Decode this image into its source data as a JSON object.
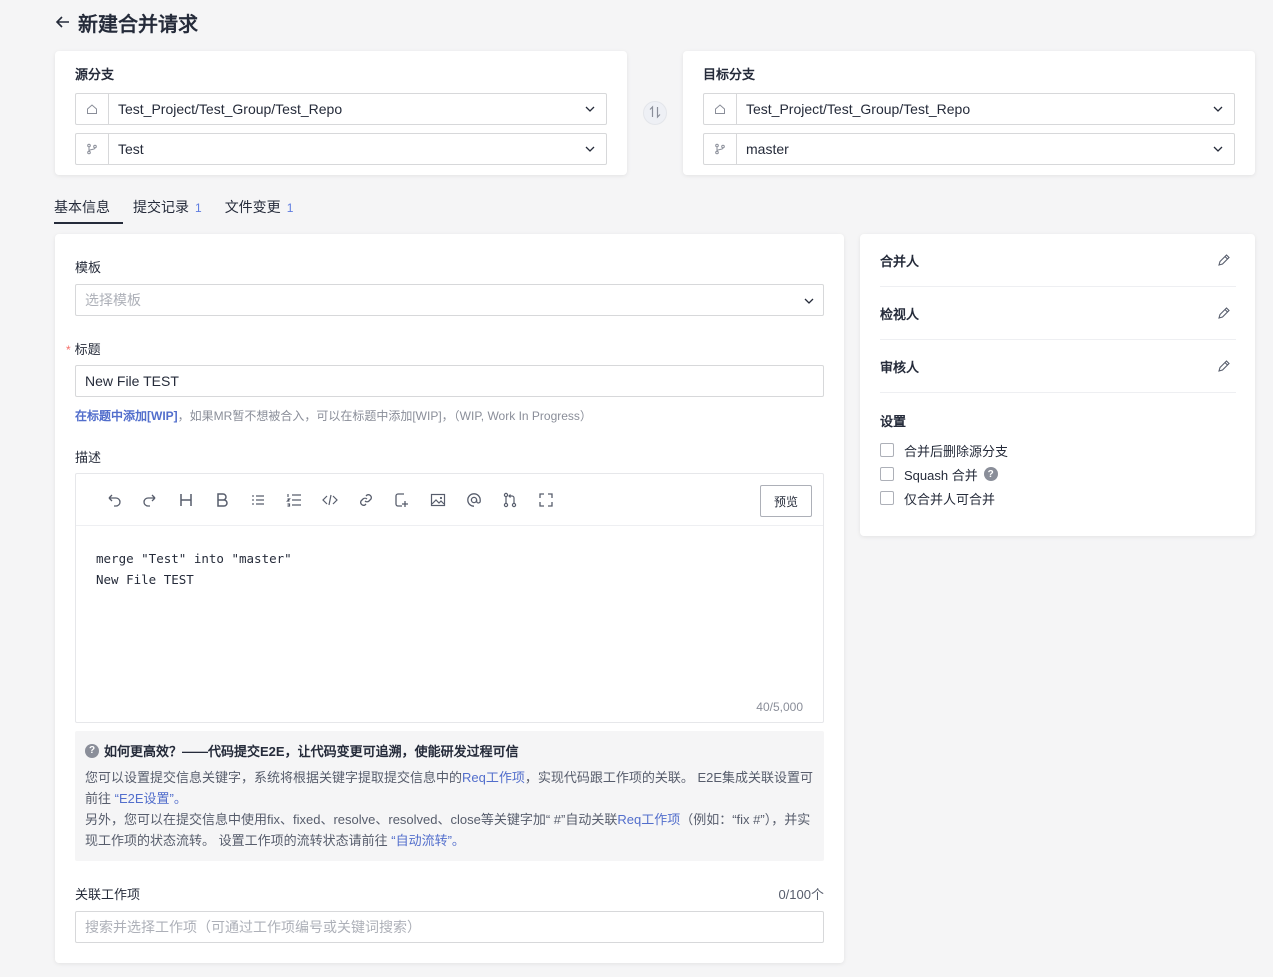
{
  "header": {
    "title": "新建合并请求"
  },
  "source": {
    "title": "源分支",
    "repo": "Test_Project/Test_Group/Test_Repo",
    "branch": "Test"
  },
  "target": {
    "title": "目标分支",
    "repo": "Test_Project/Test_Group/Test_Repo",
    "branch": "master"
  },
  "tabs": [
    {
      "label": "基本信息",
      "count": ""
    },
    {
      "label": "提交记录",
      "count": "1"
    },
    {
      "label": "文件变更",
      "count": "1"
    }
  ],
  "form": {
    "template_label": "模板",
    "template_placeholder": "选择模板",
    "required_mark": "*",
    "title_label": "标题",
    "title_value": "New File TEST",
    "wip_link": "在标题中添加[WIP]",
    "wip_hint": "，如果MR暂不想被合入，可以在标题中添加[WIP]，（WIP, Work In Progress）",
    "desc_label": "描述",
    "preview_label": "预览",
    "desc_line1": "merge \"Test\" into \"master\"",
    "desc_line2": "New File TEST",
    "char_count": "40/5,000",
    "tip_icon": "?",
    "tip_title": "如何更高效？——代码提交E2E，让代码变更可追溯，使能研发过程可信",
    "tip_p1_a": "您可以设置提交信息关键字，系统将根据关键字提取提交信息中的",
    "tip_p1_link": "Req工作项",
    "tip_p1_b": "，实现代码跟工作项的关联。 E2E集成关联设置可前往 ",
    "tip_p1_link2": "“E2E设置”。",
    "tip_p2_a": "另外，您可以在提交信息中使用fix、fixed、resolve、resolved、close等关键字加“ #”自动关联",
    "tip_p2_link": "Req工作项",
    "tip_p2_b": "（例如：“fix #”），并实现工作项的状态流转。 设置工作项的流转状态请前往 ",
    "tip_p2_link2": "“自动流转”。",
    "workitem_label": "关联工作项",
    "workitem_count": "0/100个",
    "workitem_placeholder": "搜索并选择工作项（可通过工作项编号或关键词搜索）"
  },
  "side": {
    "merger": "合并人",
    "reviewer": "检视人",
    "approver": "审核人",
    "settings_title": "设置",
    "opt_delete_source": "合并后删除源分支",
    "opt_squash": "Squash 合并",
    "opt_only_merger": "仅合并人可合并"
  },
  "colors": {
    "accent": "#526ecc",
    "text": "#252b3a",
    "background": "#f5f5f6"
  },
  "icons": [
    "back-arrow-icon",
    "repo-icon",
    "branch-icon",
    "chevron-down-icon",
    "swap-icon",
    "edit-icon",
    "help-icon"
  ]
}
